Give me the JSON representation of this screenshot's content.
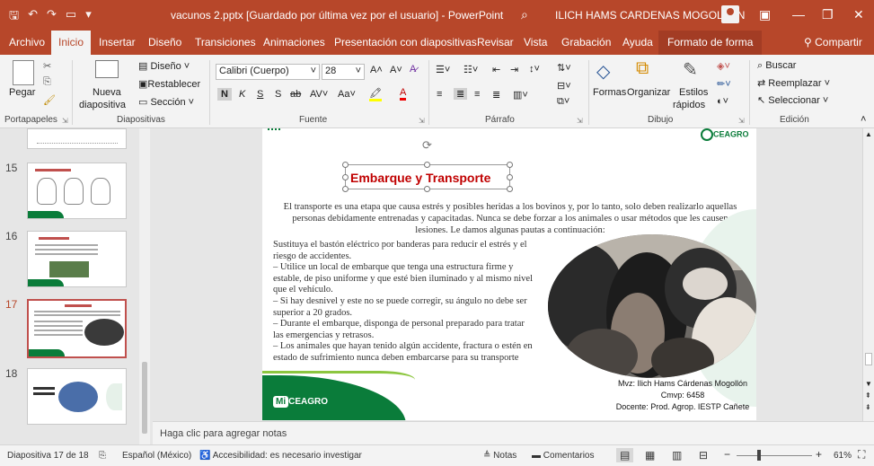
{
  "window": {
    "title": "vacunos 2.pptx [Guardado por última vez por el usuario] - PowerPoint",
    "user": "ILICH HAMS CARDENAS MOGOLLON",
    "accent": "#b7472a"
  },
  "menu": {
    "tabs": [
      "Archivo",
      "Inicio",
      "Insertar",
      "Diseño",
      "Transiciones",
      "Animaciones",
      "Presentación con diapositivas",
      "Revisar",
      "Vista",
      "Grabación",
      "Ayuda",
      "Formato de forma"
    ],
    "active": "Inicio",
    "share": "Compartir"
  },
  "ribbon": {
    "clipboard": {
      "paste": "Pegar",
      "label": "Portapapeles"
    },
    "slides": {
      "new_slide_1": "Nueva",
      "new_slide_2": "diapositiva",
      "layout": "Diseño",
      "reset": "Restablecer",
      "section": "Sección",
      "label": "Diapositivas"
    },
    "font": {
      "name": "Calibri (Cuerpo)",
      "size": "28",
      "bold": "N",
      "italic": "K",
      "underline": "S",
      "shadow": "S",
      "strike": "ab",
      "spacing": "AV",
      "case": "Aa",
      "label": "Fuente"
    },
    "paragraph": {
      "label": "Párrafo"
    },
    "drawing": {
      "shapes": "Formas",
      "arrange": "Organizar",
      "styles_1": "Estilos",
      "styles_2": "rápidos",
      "label": "Dibujo"
    },
    "editing": {
      "find": "Buscar",
      "replace": "Reemplazar",
      "select": "Seleccionar",
      "label": "Edición"
    }
  },
  "thumbnails": [
    {
      "number": "15"
    },
    {
      "number": "16"
    },
    {
      "number": "17"
    },
    {
      "number": "18"
    }
  ],
  "slide": {
    "title": "Embarque y Transporte",
    "intro": "El transporte es una etapa que causa estrés y posibles heridas a los bovinos y, por lo tanto, solo deben realizarlo aquellas personas debidamente entrenadas y capacitadas. Nunca se debe forzar a los animales o usar métodos que les causen lesiones. Le damos algunas pautas a continuación:",
    "bullets": [
      " Sustituya el bastón eléctrico por banderas para reducir el estrés y el riesgo de accidentes.",
      "– Utilice un local de embarque que tenga una estructura firme y estable, de piso uniforme y que esté bien iluminado y al mismo nivel que el vehículo.",
      "– Si hay desnivel y este no se puede corregir, su ángulo no debe ser superior a 20 grados.",
      "– Durante el embarque, disponga de personal preparado para tratar las emergencias y retrasos.",
      "– Los animales que hayan tenido algún accidente, fractura o estén en estado de sufrimiento nunca deben embarcarse para su transporte"
    ],
    "credit_1": "Mvz: Ilich Hams Cárdenas Mogollón",
    "credit_2": "Cmvp: 6458",
    "credit_3": "Docente: Prod. Agrop. IESTP Cañete",
    "logo_top": "CEAGRO",
    "logo_bottom_1": "Mi",
    "logo_bottom_2": "CEAGRO"
  },
  "notes_placeholder": "Haga clic para agregar notas",
  "status": {
    "slide": "Diapositiva 17 de 18",
    "language": "Español (México)",
    "accessibility": "Accesibilidad: es necesario investigar",
    "notes": "Notas",
    "comments": "Comentarios",
    "zoom": "61%"
  }
}
